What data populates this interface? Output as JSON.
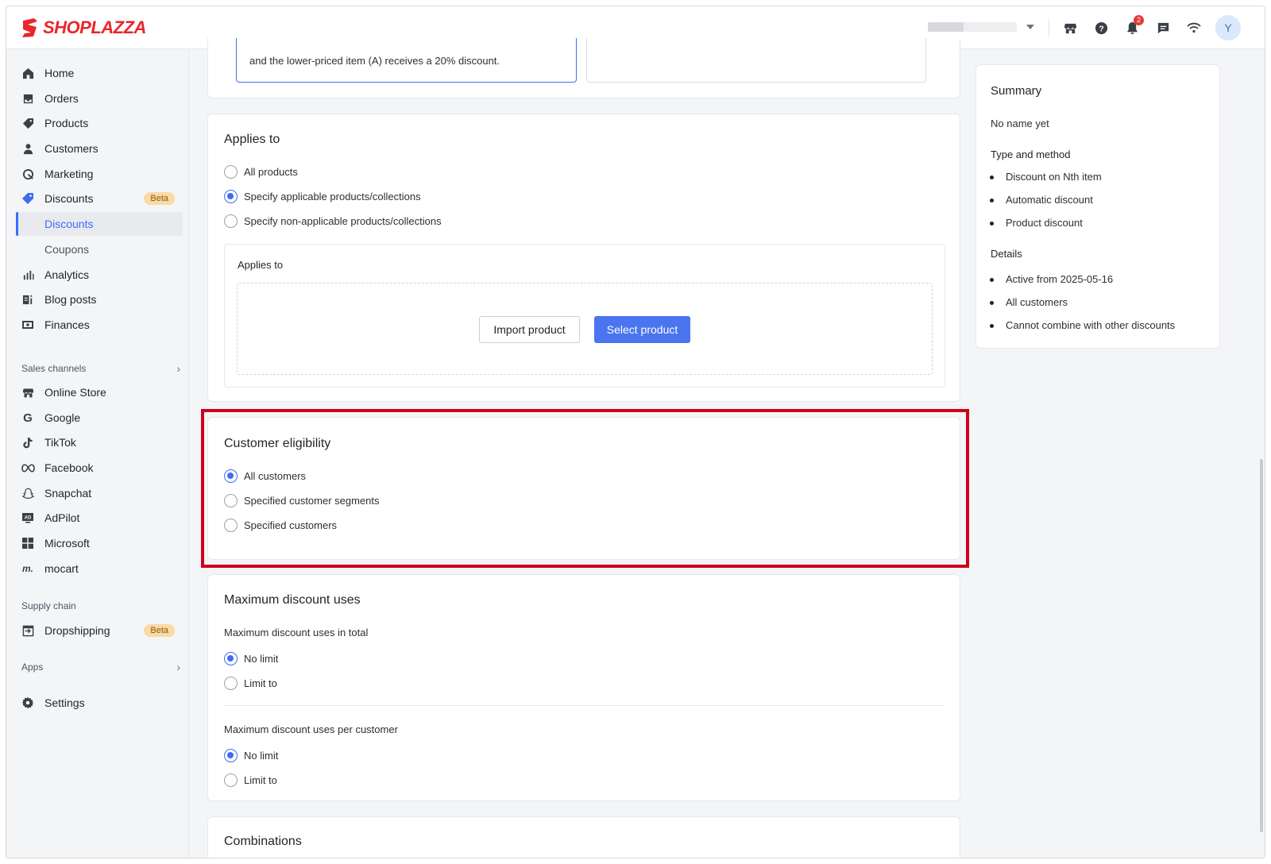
{
  "brand": {
    "name": "SHOPLAZZA",
    "color": "#e8262b"
  },
  "topbar": {
    "notification_count": "2",
    "avatar_letter": "Y"
  },
  "sidebar": {
    "items": [
      {
        "label": "Home",
        "icon": "home-icon"
      },
      {
        "label": "Orders",
        "icon": "orders-icon"
      },
      {
        "label": "Products",
        "icon": "tag-icon"
      },
      {
        "label": "Customers",
        "icon": "person-icon"
      },
      {
        "label": "Marketing",
        "icon": "marketing-icon"
      },
      {
        "label": "Discounts",
        "icon": "discount-icon",
        "badge": "Beta"
      },
      {
        "label": "Analytics",
        "icon": "analytics-icon"
      },
      {
        "label": "Blog posts",
        "icon": "blog-icon"
      },
      {
        "label": "Finances",
        "icon": "finances-icon"
      }
    ],
    "sub_items": [
      "Discounts",
      "Coupons"
    ],
    "sales_channels_title": "Sales channels",
    "channels": [
      {
        "label": "Online Store",
        "icon": "store-icon"
      },
      {
        "label": "Google",
        "icon": "google-icon"
      },
      {
        "label": "TikTok",
        "icon": "tiktok-icon"
      },
      {
        "label": "Facebook",
        "icon": "meta-icon"
      },
      {
        "label": "Snapchat",
        "icon": "snapchat-icon"
      },
      {
        "label": "AdPilot",
        "icon": "adpilot-icon"
      },
      {
        "label": "Microsoft",
        "icon": "microsoft-icon"
      },
      {
        "label": "mocart",
        "icon": "mocart-icon"
      }
    ],
    "supply_chain_title": "Supply chain",
    "dropshipping": {
      "label": "Dropshipping",
      "badge": "Beta"
    },
    "apps_title": "Apps",
    "settings_label": "Settings"
  },
  "top_card": {
    "option_text": "and the lower-priced item (A) receives a 20% discount."
  },
  "applies_to": {
    "title": "Applies to",
    "options": [
      "All products",
      "Specify applicable products/collections",
      "Specify non-applicable products/collections"
    ],
    "selected": 1,
    "inner_title": "Applies to",
    "import_button": "Import product",
    "select_button": "Select product"
  },
  "eligibility": {
    "title": "Customer eligibility",
    "options": [
      "All customers",
      "Specified customer segments",
      "Specified customers"
    ],
    "selected": 0
  },
  "max_uses": {
    "title": "Maximum discount uses",
    "total_label": "Maximum discount uses in total",
    "total_options": [
      "No limit",
      "Limit to"
    ],
    "per_customer_label": "Maximum discount uses per customer",
    "per_customer_options": [
      "No limit",
      "Limit to"
    ]
  },
  "combinations": {
    "title": "Combinations"
  },
  "summary": {
    "title": "Summary",
    "name": "No name yet",
    "type_title": "Type and method",
    "type_items": [
      "Discount on Nth item",
      "Automatic discount",
      "Product discount"
    ],
    "details_title": "Details",
    "details_items": [
      "Active from 2025-05-16",
      "All customers",
      "Cannot combine with other discounts"
    ]
  },
  "highlight_color": "#d0021b",
  "accent_color": "#3d6df2"
}
